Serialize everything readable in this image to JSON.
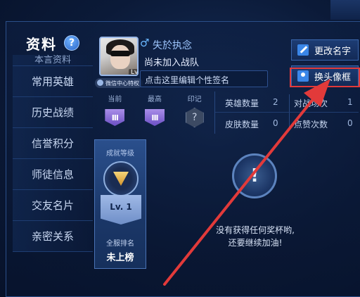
{
  "panel": {
    "title": "资料",
    "help_symbol": "?"
  },
  "sidebar": {
    "items": [
      {
        "label": "本言资料",
        "partial": true
      },
      {
        "label": "常用英雄"
      },
      {
        "label": "历史战绩"
      },
      {
        "label": "信誉积分"
      },
      {
        "label": "师徒信息"
      },
      {
        "label": "交友名片"
      },
      {
        "label": "亲密关系"
      }
    ]
  },
  "profile": {
    "gender_symbol": "♂",
    "name": "失於执念",
    "level": "Lv.4",
    "privilege_badge": "微信中心特权",
    "team_status": "尚未加入战队",
    "signature_placeholder": "点击这里编辑个性签名"
  },
  "actions": {
    "rename_label": "更改名字",
    "change_avatar_frame_label": "换头像框"
  },
  "ranks": {
    "current_label": "当前",
    "highest_label": "最高",
    "mark_label": "印记",
    "current_tier": "III",
    "highest_tier": "III",
    "mark_value": "?"
  },
  "stats": {
    "hero_count_label": "英雄数量",
    "hero_count": "2",
    "match_count_label": "对战场次",
    "match_count": "1",
    "skin_count_label": "皮肤数量",
    "skin_count": "0",
    "like_count_label": "点赞次数",
    "like_count": "0"
  },
  "achievement": {
    "title": "成就等级",
    "level": "Lv. 1",
    "rank_label": "全服排名",
    "rank_value": "未上榜"
  },
  "empty_state": {
    "line1": "没有获得任何奖杯哟,",
    "line2": "还要继续加油!"
  },
  "colors": {
    "highlight": "#e23a3a",
    "accent": "#3a86e8"
  }
}
